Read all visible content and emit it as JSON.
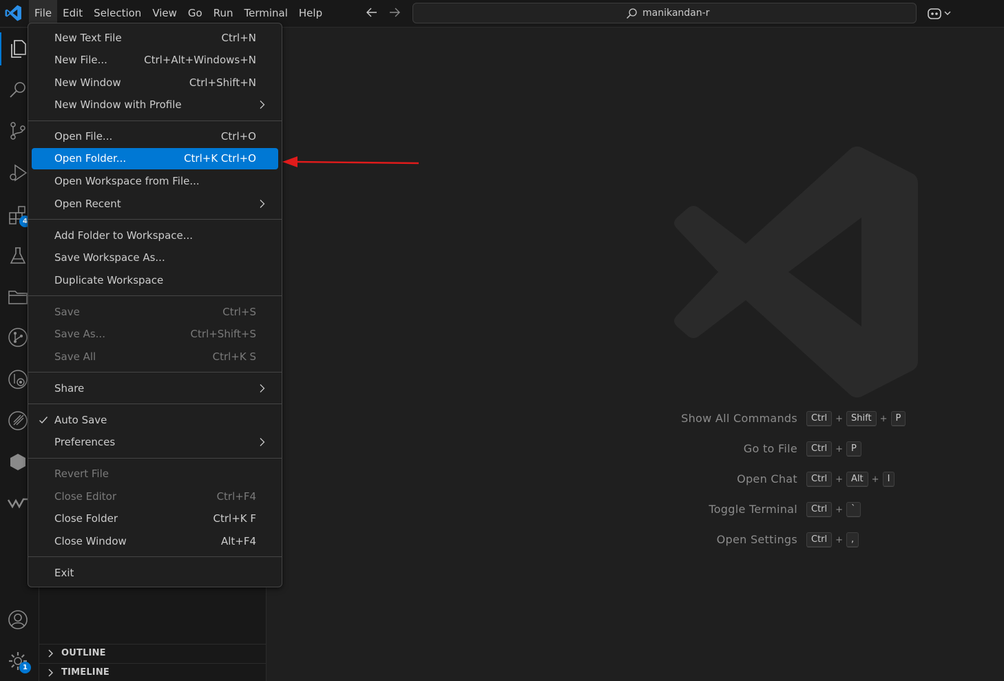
{
  "menubar": {
    "items": [
      "File",
      "Edit",
      "Selection",
      "View",
      "Go",
      "Run",
      "Terminal",
      "Help"
    ]
  },
  "command_center": {
    "label": "manikandan-r"
  },
  "activity_badges": {
    "extensions": "4",
    "manage": "1"
  },
  "sidebar": {
    "panes": [
      "OUTLINE",
      "TIMELINE"
    ]
  },
  "file_menu": {
    "items": [
      {
        "label": "New Text File",
        "key": "Ctrl+N"
      },
      {
        "label": "New File...",
        "key": "Ctrl+Alt+Windows+N"
      },
      {
        "label": "New Window",
        "key": "Ctrl+Shift+N"
      },
      {
        "label": "New Window with Profile",
        "key": ""
      },
      {
        "label": "Open File...",
        "key": "Ctrl+O"
      },
      {
        "label": "Open Folder...",
        "key": "Ctrl+K Ctrl+O"
      },
      {
        "label": "Open Workspace from File...",
        "key": ""
      },
      {
        "label": "Open Recent",
        "key": ""
      },
      {
        "label": "Add Folder to Workspace...",
        "key": ""
      },
      {
        "label": "Save Workspace As...",
        "key": ""
      },
      {
        "label": "Duplicate Workspace",
        "key": ""
      },
      {
        "label": "Save",
        "key": "Ctrl+S"
      },
      {
        "label": "Save As...",
        "key": "Ctrl+Shift+S"
      },
      {
        "label": "Save All",
        "key": "Ctrl+K S"
      },
      {
        "label": "Share",
        "key": ""
      },
      {
        "label": "Auto Save",
        "key": ""
      },
      {
        "label": "Preferences",
        "key": ""
      },
      {
        "label": "Revert File",
        "key": ""
      },
      {
        "label": "Close Editor",
        "key": "Ctrl+F4"
      },
      {
        "label": "Close Folder",
        "key": "Ctrl+K F"
      },
      {
        "label": "Close Window",
        "key": "Alt+F4"
      },
      {
        "label": "Exit",
        "key": ""
      }
    ]
  },
  "shortcuts": [
    {
      "label": "Show All Commands",
      "keys": [
        "Ctrl",
        "Shift",
        "P"
      ]
    },
    {
      "label": "Go to File",
      "keys": [
        "Ctrl",
        "P"
      ]
    },
    {
      "label": "Open Chat",
      "keys": [
        "Ctrl",
        "Alt",
        "I"
      ]
    },
    {
      "label": "Toggle Terminal",
      "keys": [
        "Ctrl",
        "`"
      ]
    },
    {
      "label": "Open Settings",
      "keys": [
        "Ctrl",
        ","
      ]
    }
  ],
  "colors": {
    "accent": "#0078d4",
    "arrow": "#e01b1b",
    "menu_bg": "#1f1f1f",
    "chrome_bg": "#181818"
  }
}
